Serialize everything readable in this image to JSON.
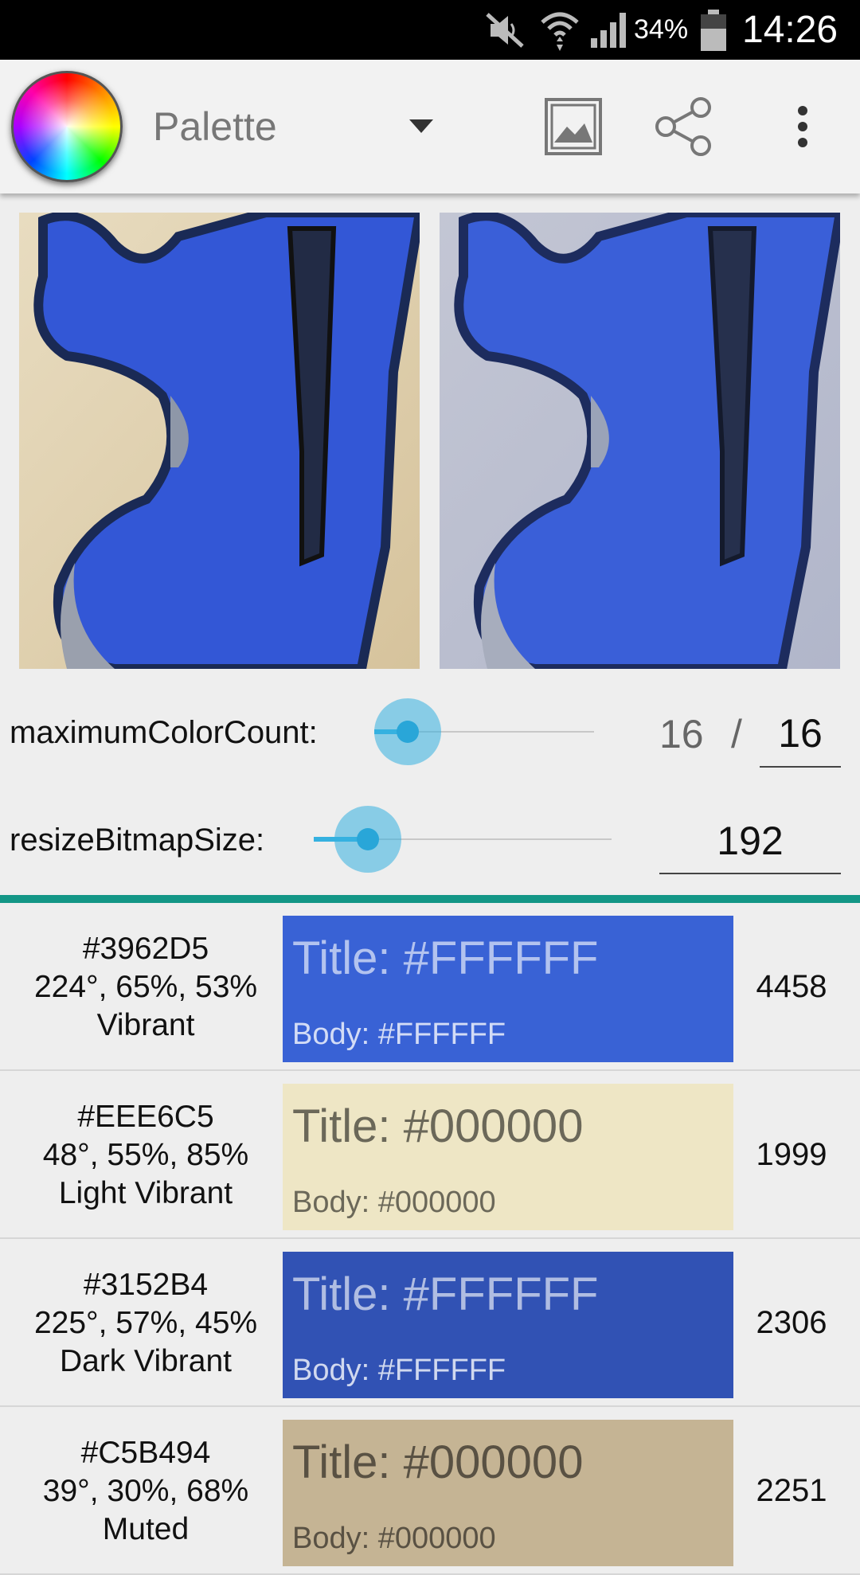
{
  "status_bar": {
    "battery_percent": "34%",
    "time": "14:26",
    "icons": [
      "mute-icon",
      "wifi-icon",
      "signal-icon",
      "battery-icon"
    ]
  },
  "action_bar": {
    "title": "Palette",
    "icons": [
      "color-wheel-icon",
      "dropdown-arrow-icon",
      "image-icon",
      "share-icon",
      "overflow-menu-icon"
    ]
  },
  "controls": {
    "max_color_count_label": "maximumColorCount:",
    "max_color_count_current": "16",
    "separator": "/",
    "max_color_count_value": "16",
    "resize_bitmap_label": "resizeBitmapSize:",
    "resize_bitmap_value": "192",
    "accent_color": "#35b1e0",
    "divider_color": "#139686"
  },
  "swatches": [
    {
      "hex": "#3962D5",
      "hsl": "224°, 65%, 53%",
      "name": "Vibrant",
      "title": "Title: #FFFFFF",
      "body": "Body: #FFFFFF",
      "population": "4458",
      "bg": "#3962D5",
      "text_color": "#FFFFFF"
    },
    {
      "hex": "#EEE6C5",
      "hsl": "48°, 55%, 85%",
      "name": "Light Vibrant",
      "title": "Title: #000000",
      "body": "Body: #000000",
      "population": "1999",
      "bg": "#EEE6C5",
      "text_color": "#000000"
    },
    {
      "hex": "#3152B4",
      "hsl": "225°, 57%, 45%",
      "name": "Dark Vibrant",
      "title": "Title: #FFFFFF",
      "body": "Body: #FFFFFF",
      "population": "2306",
      "bg": "#3152B4",
      "text_color": "#FFFFFF"
    },
    {
      "hex": "#C5B494",
      "hsl": "39°, 30%, 68%",
      "name": "Muted",
      "title": "Title: #000000",
      "body": "Body: #000000",
      "population": "2251",
      "bg": "#C5B494",
      "text_color": "#000000"
    }
  ]
}
